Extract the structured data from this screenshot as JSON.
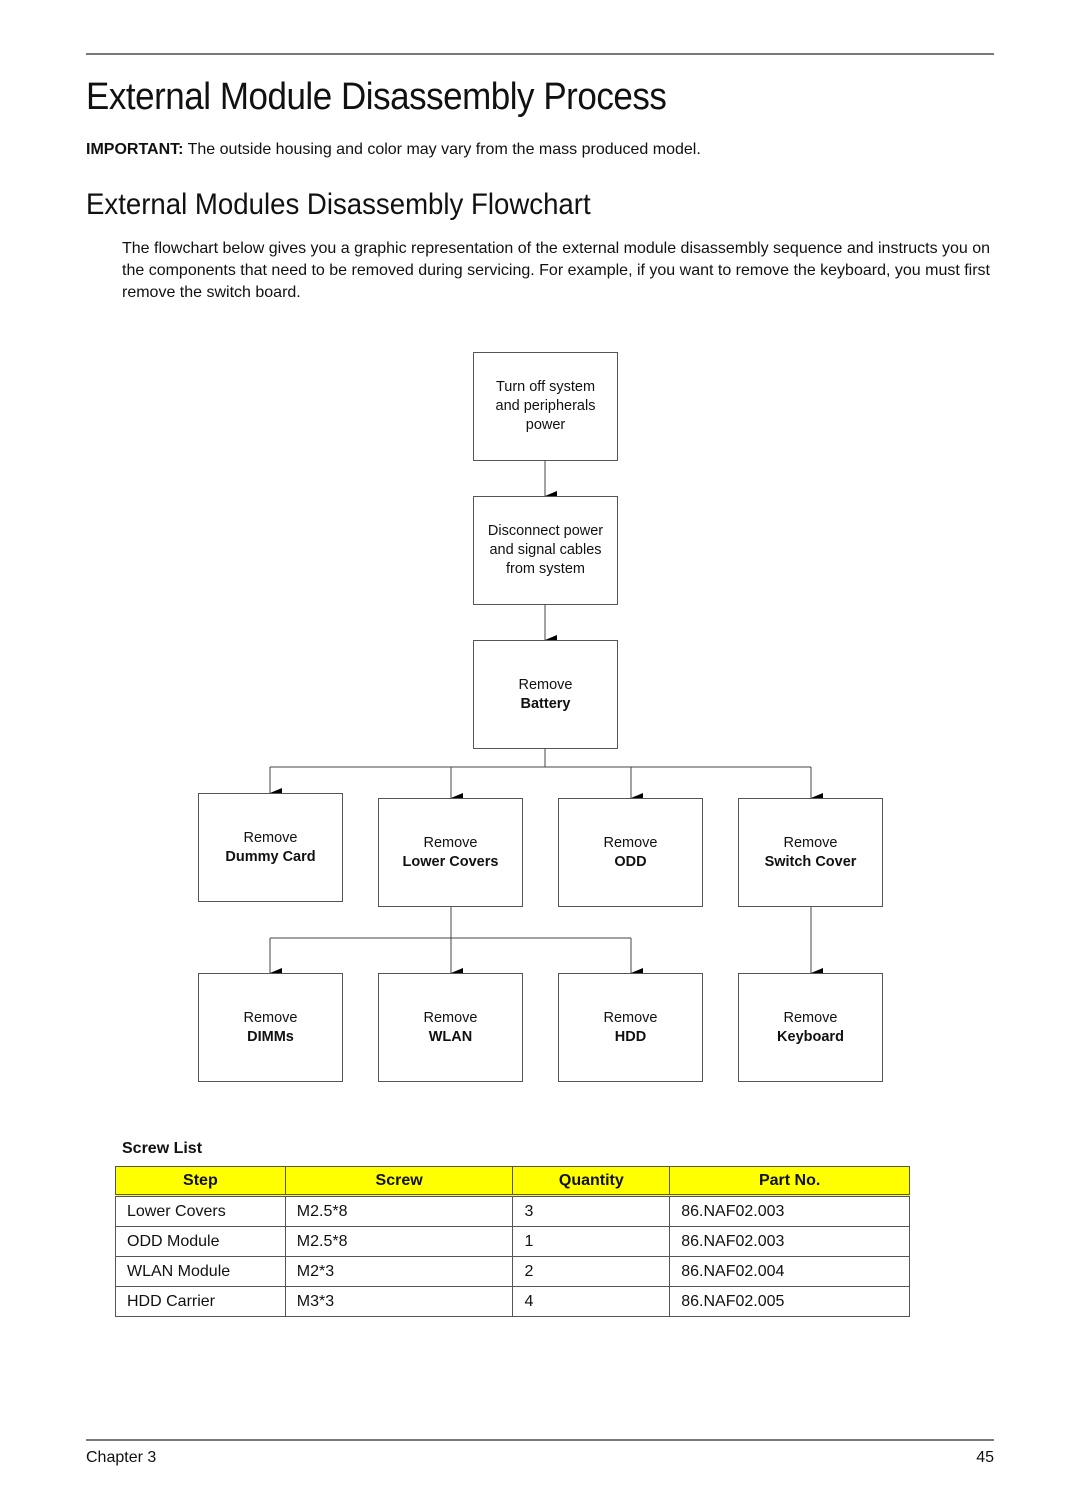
{
  "page": {
    "title": "External Module Disassembly Process",
    "important_label": "IMPORTANT:",
    "important_text": " The outside housing and color may vary from the mass produced model.",
    "section_title": "External Modules Disassembly Flowchart",
    "intro": "The flowchart below gives you a graphic representation of the external module disassembly sequence and instructs you on the components that need to be removed during servicing. For example, if you want to remove the keyboard, you must first remove the switch board."
  },
  "flowchart": {
    "steps": {
      "power_off": {
        "line1": "Turn off system",
        "line2": "and peripherals",
        "line3": "power"
      },
      "disconnect": {
        "line1": "Disconnect power",
        "line2": "and signal cables",
        "line3": "from system"
      },
      "battery": {
        "action": "Remove",
        "item": "Battery"
      },
      "dummy_card": {
        "action": "Remove",
        "item": "Dummy Card"
      },
      "lower_covers": {
        "action": "Remove",
        "item": "Lower Covers"
      },
      "odd": {
        "action": "Remove",
        "item": "ODD"
      },
      "switch_cover": {
        "action": "Remove",
        "item": "Switch Cover"
      },
      "dimms": {
        "action": "Remove",
        "item": "DIMMs"
      },
      "wlan": {
        "action": "Remove",
        "item": "WLAN"
      },
      "hdd": {
        "action": "Remove",
        "item": "HDD"
      },
      "keyboard": {
        "action": "Remove",
        "item": "Keyboard"
      }
    }
  },
  "screw_list": {
    "title": "Screw List",
    "header_color": "#ffff00",
    "columns": [
      "Step",
      "Screw",
      "Quantity",
      "Part No."
    ],
    "rows": [
      [
        "Lower Covers",
        "M2.5*8",
        "3",
        "86.NAF02.003"
      ],
      [
        "ODD Module",
        "M2.5*8",
        "1",
        "86.NAF02.003"
      ],
      [
        "WLAN Module",
        "M2*3",
        "2",
        "86.NAF02.004"
      ],
      [
        "HDD Carrier",
        "M3*3",
        "4",
        "86.NAF02.005"
      ]
    ]
  },
  "footer": {
    "chapter": "Chapter 3",
    "page_number": "45"
  }
}
